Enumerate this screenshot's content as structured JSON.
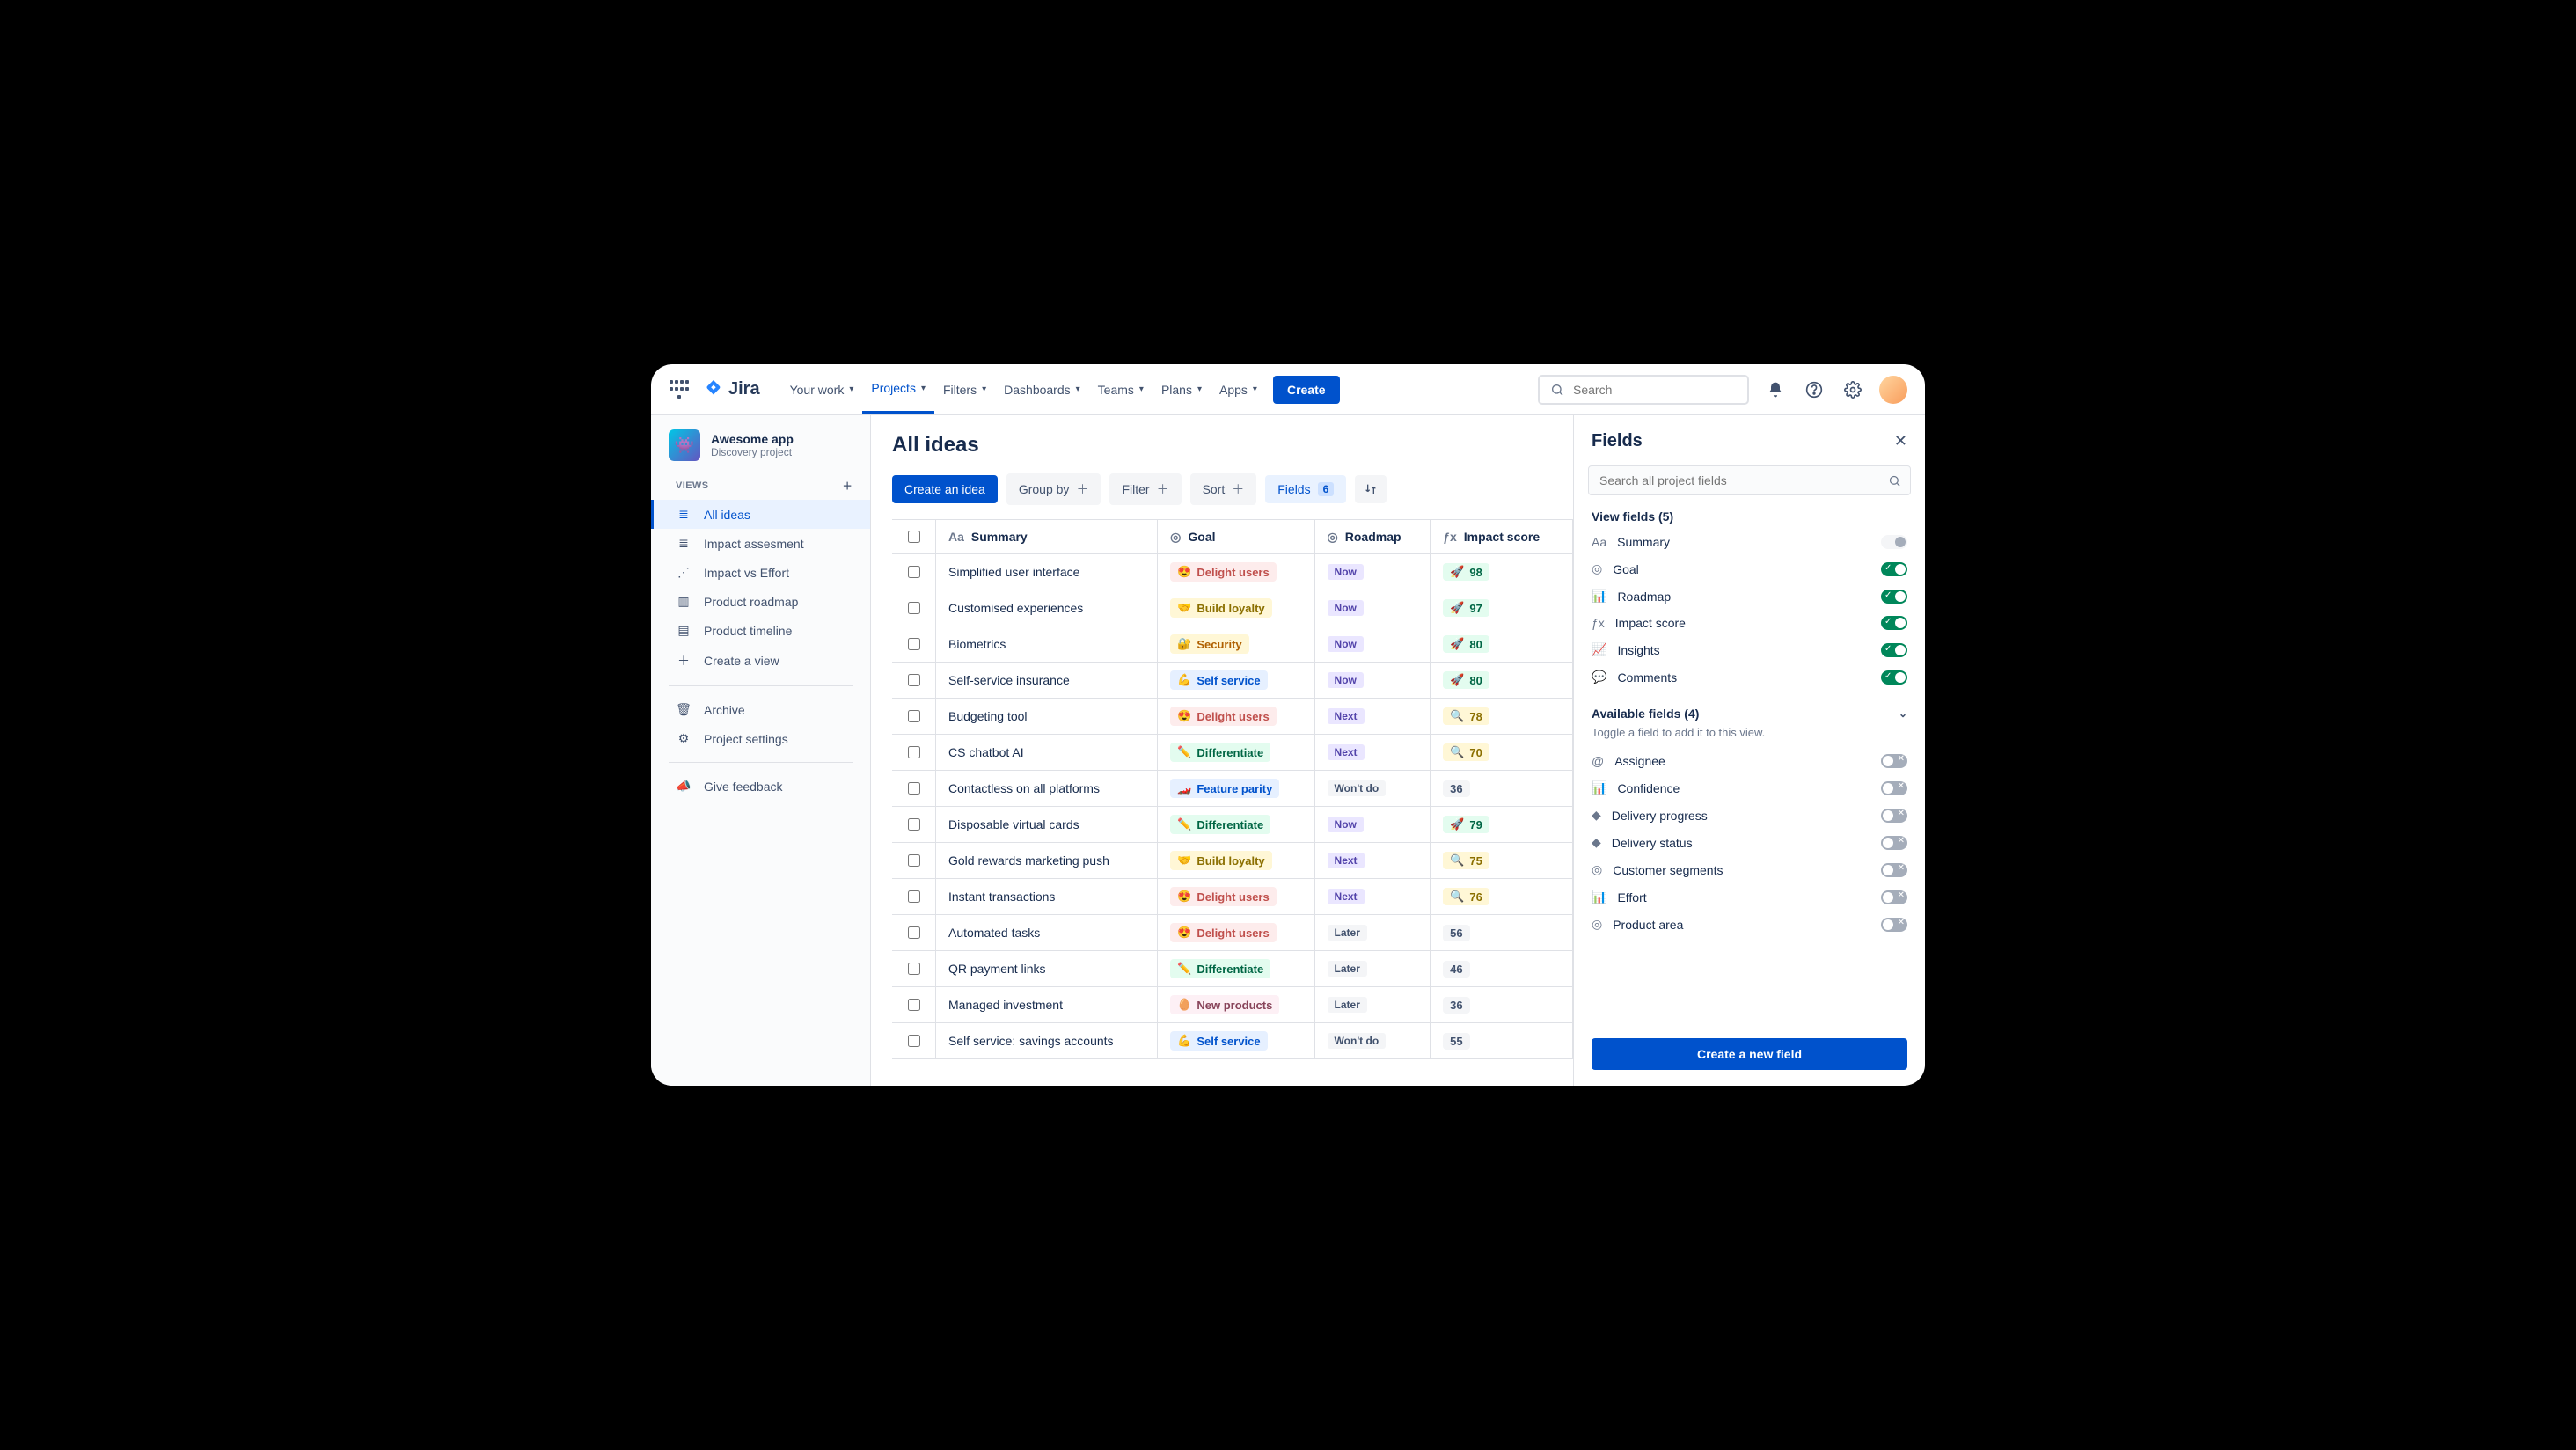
{
  "nav": {
    "logo": "Jira",
    "items": [
      "Your work",
      "Projects",
      "Filters",
      "Dashboards",
      "Teams",
      "Plans",
      "Apps"
    ],
    "active": "Projects",
    "create": "Create",
    "search_placeholder": "Search"
  },
  "project": {
    "name": "Awesome app",
    "type": "Discovery project"
  },
  "sidebar": {
    "views_header": "VIEWS",
    "views": [
      {
        "label": "All ideas",
        "icon": "list",
        "active": true
      },
      {
        "label": "Impact assesment",
        "icon": "list"
      },
      {
        "label": "Impact vs Effort",
        "icon": "scatter"
      },
      {
        "label": "Product roadmap",
        "icon": "board"
      },
      {
        "label": "Product timeline",
        "icon": "timeline"
      },
      {
        "label": "Create a view",
        "icon": "plus"
      }
    ],
    "bottom": [
      {
        "label": "Archive",
        "icon": "trash"
      },
      {
        "label": "Project settings",
        "icon": "gear"
      }
    ],
    "feedback": "Give feedback"
  },
  "page": {
    "title": "All ideas"
  },
  "toolbar": {
    "create": "Create an idea",
    "group_by": "Group by",
    "filter": "Filter",
    "sort": "Sort",
    "fields": "Fields",
    "fields_count": "6"
  },
  "columns": [
    {
      "key": "summary",
      "label": "Summary",
      "icon": "Aa"
    },
    {
      "key": "goal",
      "label": "Goal",
      "icon": "target"
    },
    {
      "key": "roadmap",
      "label": "Roadmap",
      "icon": "target"
    },
    {
      "key": "impact",
      "label": "Impact score",
      "icon": "fx"
    }
  ],
  "goal_styles": {
    "Delight users": {
      "cls": "delight",
      "emoji": "😍"
    },
    "Build loyalty": {
      "cls": "loyalty",
      "emoji": "🤝"
    },
    "Security": {
      "cls": "security",
      "emoji": "🔐"
    },
    "Self service": {
      "cls": "selfservice",
      "emoji": "💪"
    },
    "Differentiate": {
      "cls": "differentiate",
      "emoji": "✏️"
    },
    "Feature parity": {
      "cls": "featureparity",
      "emoji": "🏎️"
    },
    "New products": {
      "cls": "newproducts",
      "emoji": "🥚"
    }
  },
  "rows": [
    {
      "summary": "Simplified user interface",
      "goal": "Delight users",
      "roadmap": "Now",
      "impact": 98,
      "rocket": true
    },
    {
      "summary": "Customised experiences",
      "goal": "Build loyalty",
      "roadmap": "Now",
      "impact": 97,
      "rocket": true
    },
    {
      "summary": "Biometrics",
      "goal": "Security",
      "roadmap": "Now",
      "impact": 80,
      "rocket": true
    },
    {
      "summary": "Self-service insurance",
      "goal": "Self service",
      "roadmap": "Now",
      "impact": 80,
      "rocket": true
    },
    {
      "summary": "Budgeting tool",
      "goal": "Delight users",
      "roadmap": "Next",
      "impact": 78,
      "insight": true
    },
    {
      "summary": "CS chatbot AI",
      "goal": "Differentiate",
      "roadmap": "Next",
      "impact": 70,
      "insight": true
    },
    {
      "summary": "Contactless on all platforms",
      "goal": "Feature parity",
      "roadmap": "Won't do",
      "impact": 36,
      "plain": true
    },
    {
      "summary": "Disposable virtual cards",
      "goal": "Differentiate",
      "roadmap": "Now",
      "impact": 79,
      "rocket": true
    },
    {
      "summary": "Gold rewards marketing push",
      "goal": "Build loyalty",
      "roadmap": "Next",
      "impact": 75,
      "insight": true
    },
    {
      "summary": "Instant transactions",
      "goal": "Delight users",
      "roadmap": "Next",
      "impact": 76,
      "insight": true
    },
    {
      "summary": "Automated tasks",
      "goal": "Delight users",
      "roadmap": "Later",
      "impact": 56,
      "plain": true
    },
    {
      "summary": "QR payment links",
      "goal": "Differentiate",
      "roadmap": "Later",
      "impact": 46,
      "plain": true
    },
    {
      "summary": "Managed investment",
      "goal": "New products",
      "roadmap": "Later",
      "impact": 36,
      "plain": true
    },
    {
      "summary": "Self service: savings accounts",
      "goal": "Self service",
      "roadmap": "Won't do",
      "impact": 55,
      "plain": true
    }
  ],
  "panel": {
    "title": "Fields",
    "search_placeholder": "Search all project fields",
    "view_header": "View fields (5)",
    "view_fields": [
      {
        "label": "Summary",
        "icon": "Aa",
        "locked": true
      },
      {
        "label": "Goal",
        "icon": "target",
        "on": true
      },
      {
        "label": "Roadmap",
        "icon": "bars",
        "on": true
      },
      {
        "label": "Impact score",
        "icon": "fx",
        "on": true
      },
      {
        "label": "Insights",
        "icon": "trend",
        "on": true
      },
      {
        "label": "Comments",
        "icon": "comment",
        "on": true
      }
    ],
    "avail_header": "Available fields (4)",
    "avail_hint": "Toggle a field to add it to this view.",
    "avail_fields": [
      {
        "label": "Assignee",
        "icon": "@"
      },
      {
        "label": "Confidence",
        "icon": "bars"
      },
      {
        "label": "Delivery progress",
        "icon": "diamond"
      },
      {
        "label": "Delivery status",
        "icon": "diamond"
      },
      {
        "label": "Customer segments",
        "icon": "target"
      },
      {
        "label": "Effort",
        "icon": "bars"
      },
      {
        "label": "Product area",
        "icon": "target"
      }
    ],
    "create_button": "Create a new field"
  }
}
